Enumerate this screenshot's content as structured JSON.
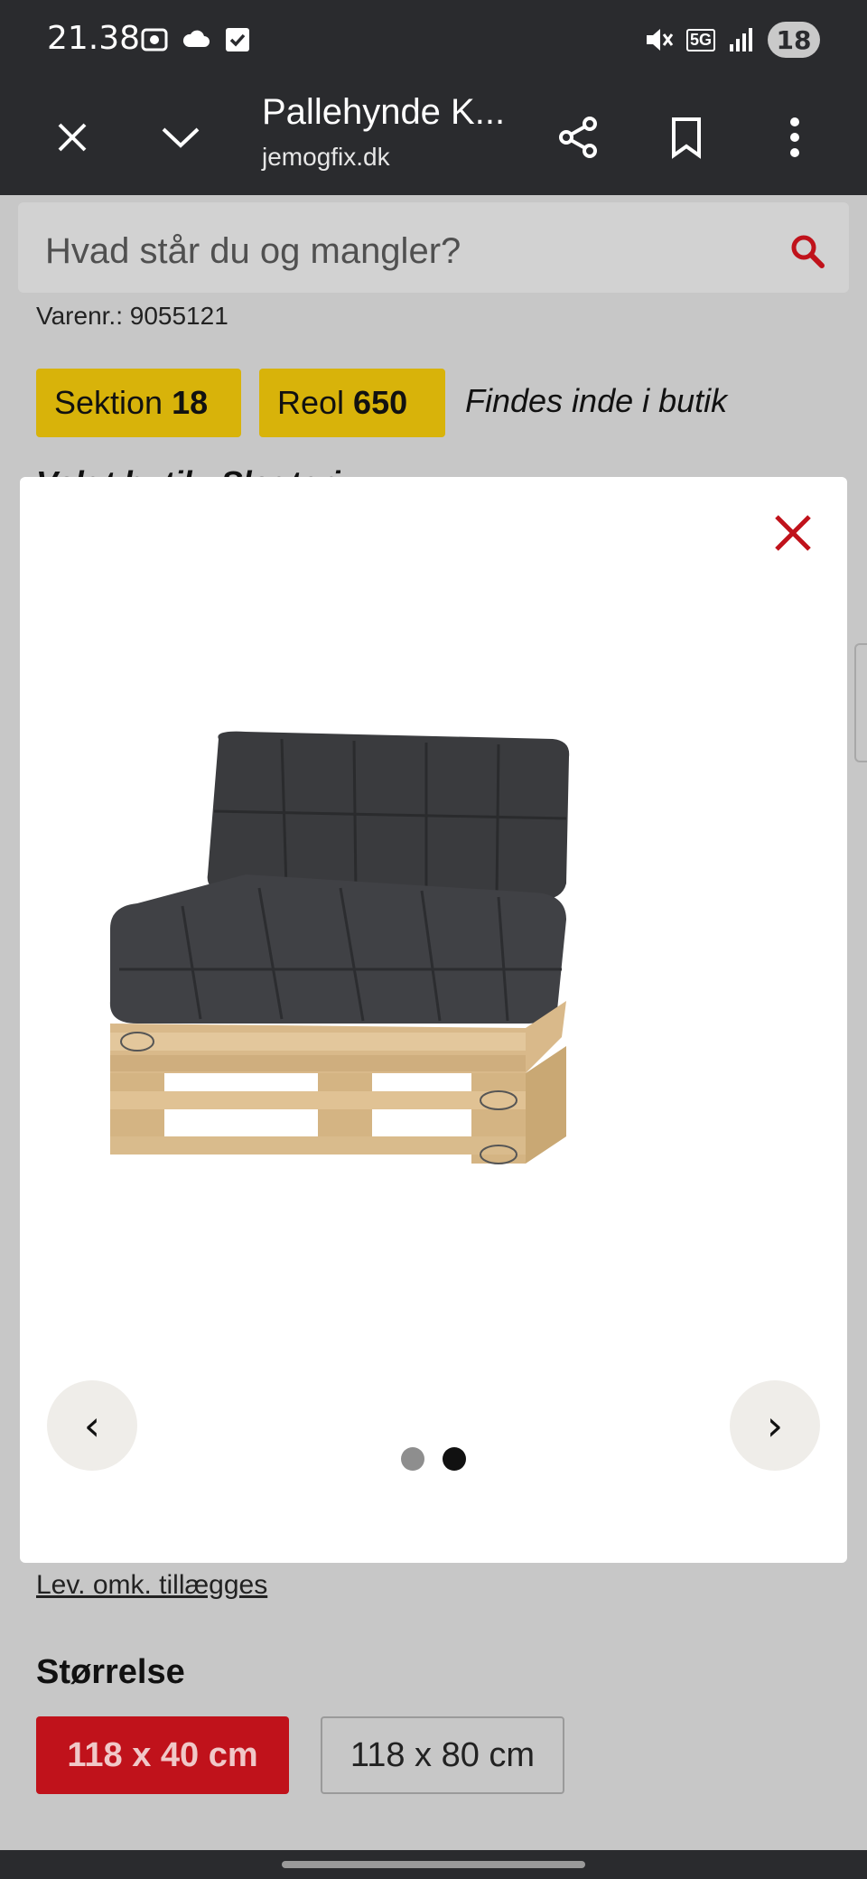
{
  "status_bar": {
    "time": "21.38",
    "battery": "18",
    "network": "5G"
  },
  "browser": {
    "title": "Pallehynde K...",
    "url": "jemogfix.dk"
  },
  "search": {
    "placeholder": "Hvad står du og mangler?"
  },
  "product": {
    "varenr": "Varenr.: 9055121",
    "sektion_label": "Sektion",
    "sektion_value": "18",
    "reol_label": "Reol",
    "reol_value": "650",
    "in_store": "Findes inde i butik",
    "store_line": "Valgt butik: Slagteri",
    "delivery_note": "Lev. omk. tillægges",
    "size_heading": "Størrelse",
    "sizes": [
      {
        "label": "118 x 40 cm",
        "selected": true
      },
      {
        "label": "118 x 80 cm",
        "selected": false
      }
    ]
  },
  "gallery": {
    "prev_label": "‹",
    "next_label": "›",
    "image_count": 2,
    "active_index": 1,
    "image_icon": "pallet-cushion-image"
  },
  "colors": {
    "brand_red": "#c0121b",
    "chip_yellow": "#d8b30a",
    "toolbar_dark": "#2a2b2e"
  }
}
